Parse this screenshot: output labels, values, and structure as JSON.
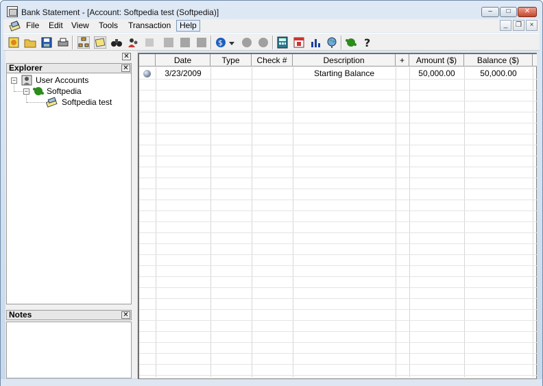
{
  "window": {
    "title": "Bank Statement - [Account: Softpedia test (Softpedia)]",
    "minimize": "–",
    "maximize": "□",
    "close": "✕"
  },
  "menu": {
    "items": [
      "File",
      "Edit",
      "View",
      "Tools",
      "Transaction",
      "Help"
    ],
    "mdi_minimize": "_",
    "mdi_restore": "❐",
    "mdi_close": "×"
  },
  "toolbar": {
    "icons": [
      "new-icon",
      "open-folder-icon",
      "save-icon",
      "print-icon",
      "tree-view-icon",
      "notes-icon",
      "find-icon",
      "users-icon",
      "disabled-icon",
      "disabled-icon",
      "disabled-icon",
      "transfer-icon",
      "dropdown-icon",
      "disabled-circle-icon",
      "disabled-circle-icon",
      "calculator-icon",
      "calendar-icon",
      "chart-icon",
      "globe-icon",
      "turtle-icon",
      "help-icon"
    ]
  },
  "explorer": {
    "title": "Explorer",
    "close": "✕",
    "tree": {
      "root": "User Accounts",
      "child": "Softpedia",
      "grandchild": "Softpedia test"
    }
  },
  "notes": {
    "title": "Notes",
    "close": "✕"
  },
  "grid": {
    "columns": [
      "",
      "Date",
      "Type",
      "Check #",
      "Description",
      "+",
      "Amount ($)",
      "Balance ($)"
    ],
    "rows": [
      {
        "date": "3/23/2009",
        "type": "",
        "check": "",
        "description": "Starting Balance",
        "flag": "",
        "amount": "50,000.00",
        "balance": "50,000.00"
      }
    ]
  },
  "colors": {
    "accent": "#6d8aa8",
    "grid_line": "#d6d6d6",
    "tree_green": "#2e8b1e"
  }
}
